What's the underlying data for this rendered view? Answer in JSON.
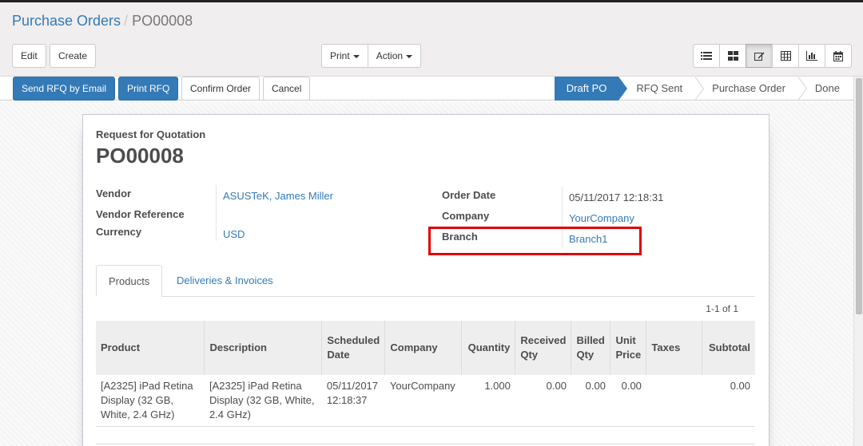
{
  "breadcrumb": {
    "parent": "Purchase Orders",
    "separator": "/",
    "current": "PO00008"
  },
  "toolbar": {
    "edit_label": "Edit",
    "create_label": "Create",
    "print_label": "Print",
    "action_label": "Action",
    "views": [
      "list-view-icon",
      "kanban-view-icon",
      "form-view-icon",
      "pivot-view-icon",
      "graph-view-icon",
      "calendar-view-icon"
    ],
    "active_view": "form-view-icon"
  },
  "header_buttons": {
    "send_rfq": "Send RFQ by Email",
    "print_rfq": "Print RFQ",
    "confirm": "Confirm Order",
    "cancel": "Cancel"
  },
  "status": {
    "steps": [
      "Draft PO",
      "RFQ Sent",
      "Purchase Order",
      "Done"
    ],
    "active": "Draft PO"
  },
  "form": {
    "subtitle": "Request for Quotation",
    "name": "PO00008",
    "vendor_label": "Vendor",
    "vendor_value": "ASUSTeK, James Miller",
    "vendor_ref_label": "Vendor Reference",
    "vendor_ref_value": "",
    "currency_label": "Currency",
    "currency_value": "USD",
    "order_date_label": "Order Date",
    "order_date_value": "05/11/2017 12:18:31",
    "company_label": "Company",
    "company_value": "YourCompany",
    "branch_label": "Branch",
    "branch_value": "Branch1"
  },
  "tabs": [
    "Products",
    "Deliveries & Invoices"
  ],
  "pager": "1-1 of 1",
  "lines": {
    "headers": {
      "product": "Product",
      "description": "Description",
      "scheduled_date": "Scheduled Date",
      "company": "Company",
      "quantity": "Quantity",
      "received_qty": "Received Qty",
      "billed_qty": "Billed Qty",
      "unit_price": "Unit Price",
      "taxes": "Taxes",
      "subtotal": "Subtotal"
    },
    "rows": [
      {
        "product": "[A2325] iPad Retina Display (32 GB, White, 2.4 GHz)",
        "description": "[A2325] iPad Retina Display (32 GB, White, 2.4 GHz)",
        "scheduled_date": "05/11/2017 12:18:37",
        "company": "YourCompany",
        "quantity": "1.000",
        "received_qty": "0.00",
        "billed_qty": "0.00",
        "unit_price": "0.00",
        "taxes": "",
        "subtotal": "0.00"
      }
    ]
  },
  "colors": {
    "primary": "#337ab7",
    "highlight": "#e00000",
    "text": "#4c4c4c"
  }
}
